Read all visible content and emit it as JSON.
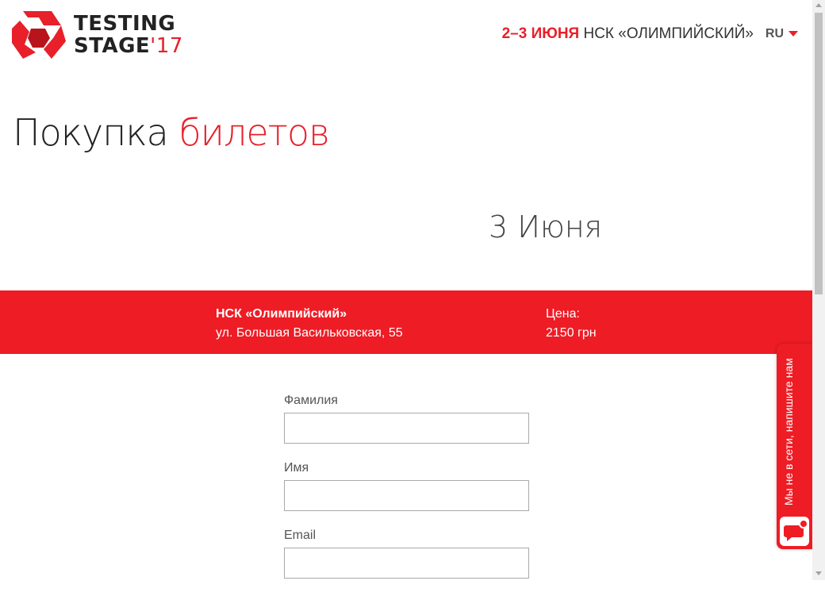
{
  "header": {
    "logo": {
      "line1": "TESTING",
      "line2": "STAGE",
      "year": "'17"
    },
    "event_dates": "2–3 ИЮНЯ",
    "event_venue": "НСК «ОЛИМПИЙСКИЙ»",
    "language": "RU"
  },
  "page": {
    "title_part1": "Покупка",
    "title_part2": "билетов",
    "day_title": "3 Июня"
  },
  "info_bar": {
    "venue_name": "НСК «Олимпийский»",
    "venue_address": "ул. Большая Васильковская, 55",
    "price_label": "Цена:",
    "price_value": "2150 грн"
  },
  "form": {
    "fields": [
      {
        "label": "Фамилия",
        "value": ""
      },
      {
        "label": "Имя",
        "value": ""
      },
      {
        "label": "Email",
        "value": ""
      }
    ]
  },
  "chat": {
    "text": "Мы не в сети, напишите нам"
  },
  "colors": {
    "accent": "#ee1c25",
    "text": "#333333"
  }
}
